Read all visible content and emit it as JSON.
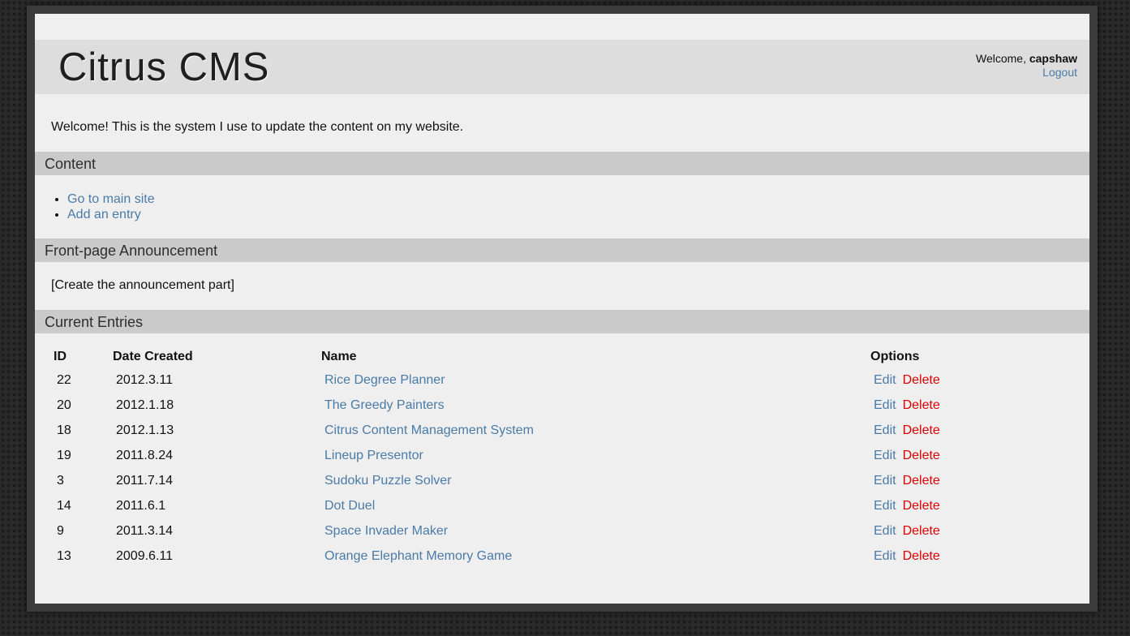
{
  "header": {
    "title": "Citrus CMS",
    "welcome_prefix": "Welcome, ",
    "username": "capshaw",
    "logout_label": "Logout"
  },
  "intro_text": "Welcome! This is the system I use to update the content on my website.",
  "sections": {
    "content": "Content",
    "announcement": "Front-page Announcement",
    "entries": "Current Entries"
  },
  "content_links": [
    "Go to main site",
    "Add an entry"
  ],
  "announcement_text": "[Create the announcement part]",
  "table": {
    "headers": [
      "ID",
      "Date Created",
      "Name",
      "Options"
    ],
    "edit_label": "Edit",
    "delete_label": "Delete",
    "rows": [
      {
        "id": "22",
        "date": "2012.3.11",
        "name": "Rice Degree Planner"
      },
      {
        "id": "20",
        "date": "2012.1.18",
        "name": "The Greedy Painters"
      },
      {
        "id": "18",
        "date": "2012.1.13",
        "name": "Citrus Content Management System"
      },
      {
        "id": "19",
        "date": "2011.8.24",
        "name": "Lineup Presentor"
      },
      {
        "id": "3",
        "date": "2011.7.14",
        "name": "Sudoku Puzzle Solver"
      },
      {
        "id": "14",
        "date": "2011.6.1",
        "name": "Dot Duel"
      },
      {
        "id": "9",
        "date": "2011.3.14",
        "name": "Space Invader Maker"
      },
      {
        "id": "13",
        "date": "2009.6.11",
        "name": "Orange Elephant Memory Game"
      }
    ]
  },
  "colors": {
    "link": "#4a7ba6",
    "delete": "#dd0000",
    "section_bar": "#cacaca",
    "header_bg": "#dddddd",
    "page_bg": "#efefef"
  }
}
